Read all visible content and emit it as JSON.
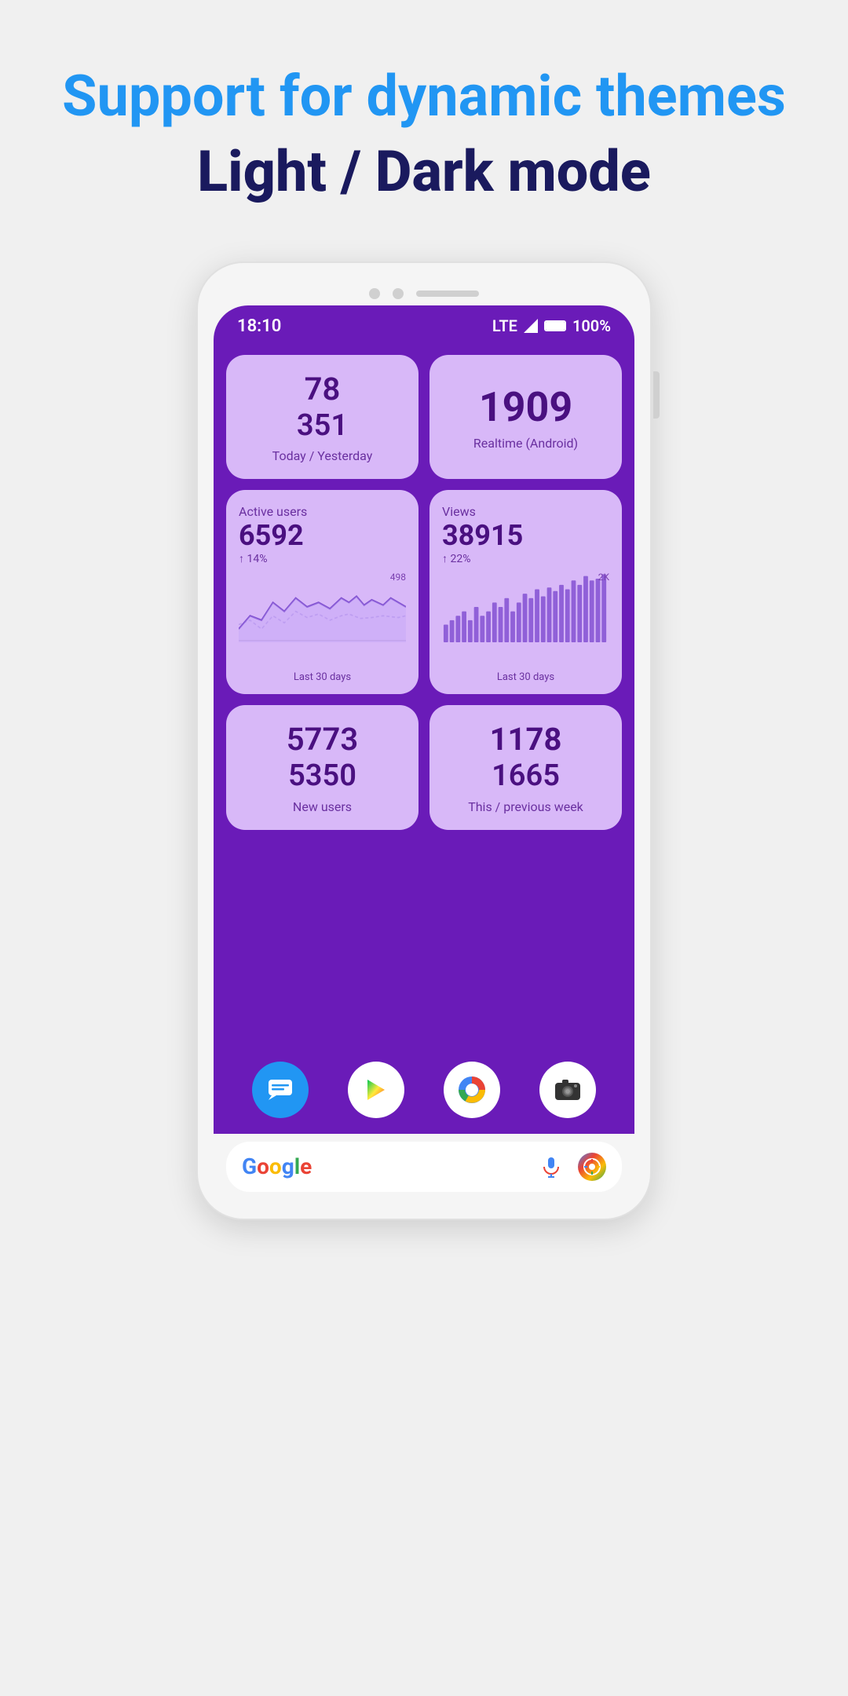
{
  "header": {
    "line1": "Support for dynamic",
    "line2": "themes",
    "line3": "Light / Dark mode"
  },
  "status_bar": {
    "time": "18:10",
    "signal": "LTE",
    "battery": "100%"
  },
  "cards": {
    "today": {
      "number1": "78",
      "number2": "351",
      "label": "Today / Yesterday"
    },
    "realtime": {
      "number": "1909",
      "label": "Realtime (Android)"
    },
    "active_users": {
      "title": "Active users",
      "number": "6592",
      "percent": "↑ 14%",
      "chart_max": "498",
      "bottom_label": "Last 30 days"
    },
    "views": {
      "title": "Views",
      "number": "38915",
      "percent": "↑ 22%",
      "chart_max": "2K",
      "bottom_label": "Last 30 days"
    },
    "new_users": {
      "number1": "5773",
      "number2": "5350",
      "label": "New users"
    },
    "week": {
      "number1": "1178",
      "number2": "1665",
      "label": "This / previous week"
    }
  },
  "dock": {
    "icons": [
      "messages",
      "play-store",
      "chrome",
      "camera"
    ]
  },
  "search_bar": {
    "google_text": "Google"
  }
}
